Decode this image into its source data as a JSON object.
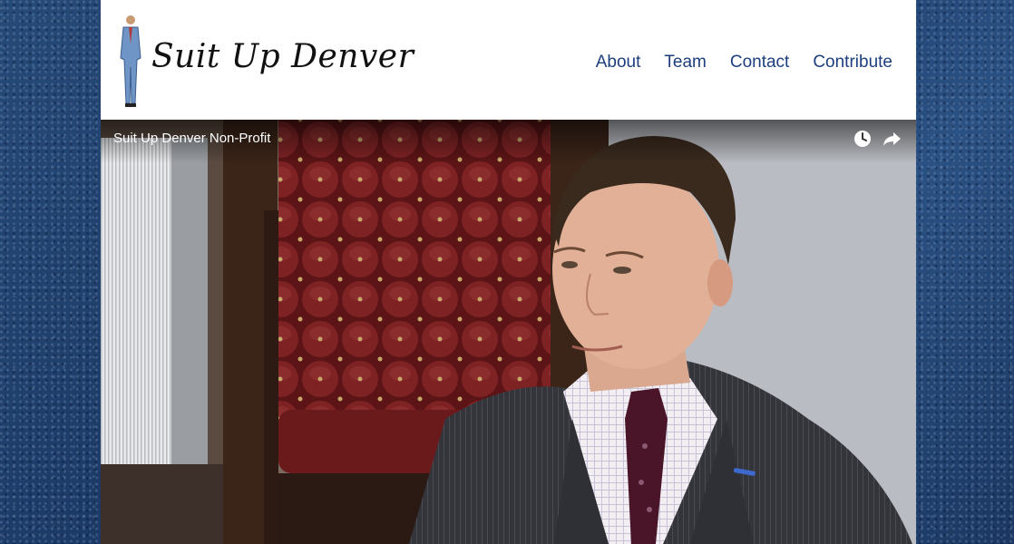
{
  "site": {
    "brand": "Suit Up Denver",
    "nav": [
      "About",
      "Team",
      "Contact",
      "Contribute"
    ]
  },
  "video": {
    "title": "Suit Up Denver Non-Profit",
    "icons": [
      "watch-later-icon",
      "share-icon"
    ]
  },
  "colors": {
    "background": "#1f3f6a",
    "header": "#ffffff",
    "nav_link": "#1d3e7e"
  }
}
